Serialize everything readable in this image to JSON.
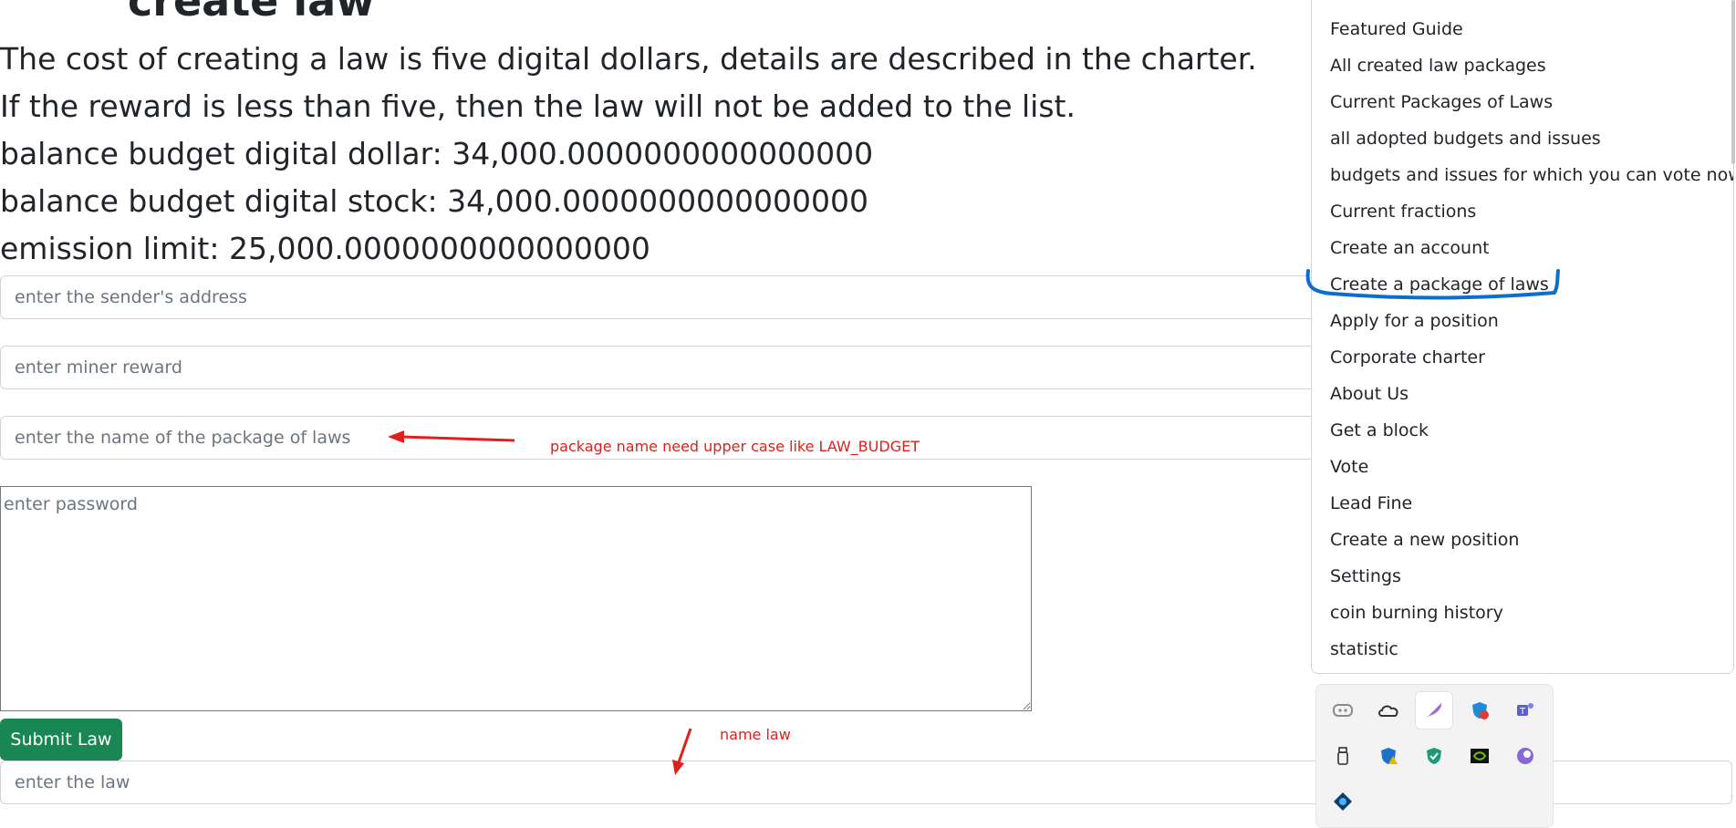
{
  "page": {
    "title": "create law",
    "info_lines": [
      "The cost of creating a law is five digital dollars, details are described in the charter.",
      "If the reward is less than five, then the law will not be added to the list.",
      "balance budget digital dollar: 34,000.0000000000000000",
      "balance budget digital stock: 34,000.0000000000000000",
      "emission limit: 25,000.0000000000000000"
    ]
  },
  "form": {
    "sender_placeholder": "enter the sender's address",
    "miner_reward_placeholder": "enter miner reward",
    "package_name_placeholder": "enter the name of the package of laws",
    "password_placeholder": "enter password",
    "submit_label": "Submit Law",
    "law_placeholder": "enter the law"
  },
  "annotations": {
    "package_note": "package name need upper case like LAW_BUDGET",
    "law_note": "name law",
    "arrow_color": "#e0201a",
    "highlight_color": "#0a6ed1"
  },
  "nav_menu": {
    "highlighted_item": "Create a package of laws",
    "items": [
      "Featured Guide",
      "All created law packages",
      "Current Packages of Laws",
      "all adopted budgets and issues",
      "budgets and issues for which you can vote now.",
      "Current fractions",
      "Create an account",
      "Create a package of laws",
      "Apply for a position",
      "Corporate charter",
      "About Us",
      "Get a block",
      "Vote",
      "Lead Fine",
      "Create a new position",
      "Settings",
      "coin burning history",
      "statistic"
    ]
  },
  "colors": {
    "submit_button": "#198754",
    "text": "#212529",
    "placeholder": "#6c757d"
  },
  "tray_icons": [
    "discord-icon",
    "onedrive-cloud-icon",
    "feather-pen-icon",
    "security-shield-icon",
    "teams-icon",
    "usb-drive-icon",
    "defender-warning-icon",
    "shield-check-icon",
    "nvidia-icon",
    "browser-icon",
    "diamond-app-icon"
  ]
}
